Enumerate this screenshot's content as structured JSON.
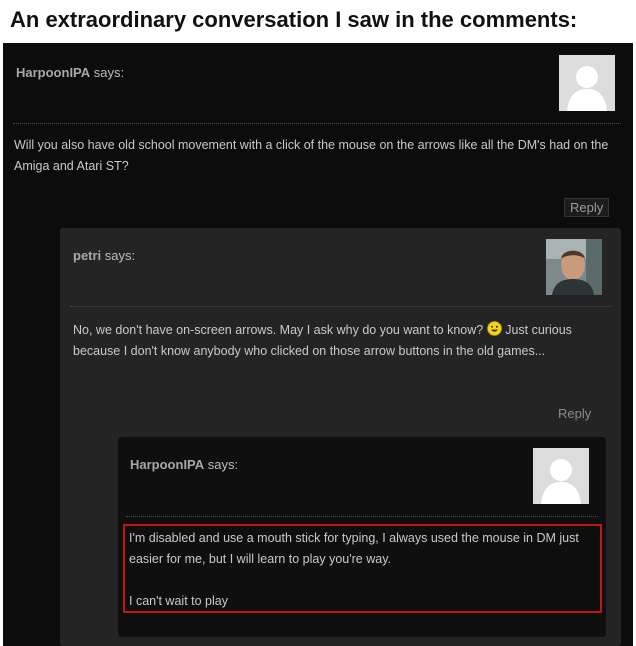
{
  "headline": "An extraordinary conversation I saw in the comments:",
  "comments": [
    {
      "author": "HarpoonIPA",
      "says": "says:",
      "avatar": "default-avatar",
      "text": "Will you also have old school movement with a click of the mouse on the arrows like all the DM's had on the Amiga and Atari ST?",
      "reply_label": "Reply"
    },
    {
      "author": "petri",
      "says": "says:",
      "avatar": "photo-avatar",
      "text_before": "No, we don't have on-screen arrows. May I ask why do you want to know?",
      "emoticon": "smiley-icon",
      "text_after": "Just curious because I don't know anybody who clicked on those arrow buttons in the old games...",
      "reply_label": "Reply"
    },
    {
      "author": "HarpoonIPA",
      "says": "says:",
      "avatar": "default-avatar",
      "text_line1": "I'm disabled and use a mouth stick for typing, I always used the mouse in DM just easier for me, but I will learn to play you're way.",
      "text_line2": "I can't wait to play"
    }
  ],
  "colors": {
    "board_background": "#0c0c0c",
    "nested_background": "#242424",
    "highlight_border": "#c0151b"
  }
}
